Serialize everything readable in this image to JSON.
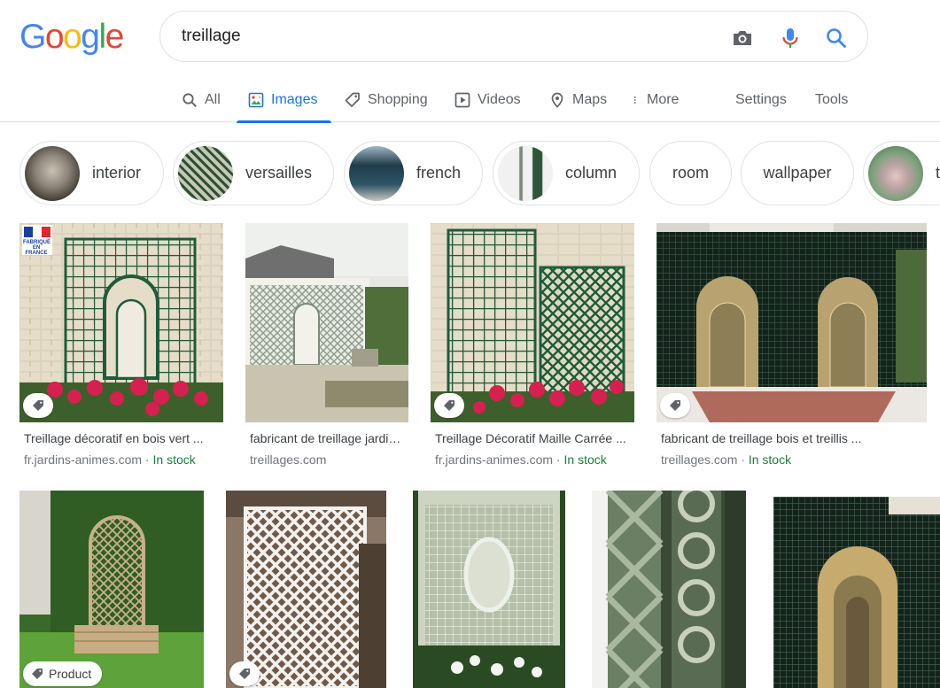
{
  "logo": {
    "letters": [
      "G",
      "o",
      "o",
      "g",
      "l",
      "e"
    ]
  },
  "search": {
    "query": "treillage"
  },
  "tabs": {
    "all": "All",
    "images": "Images",
    "shopping": "Shopping",
    "videos": "Videos",
    "maps": "Maps",
    "more": "More",
    "settings": "Settings",
    "tools": "Tools"
  },
  "chips": [
    "interior",
    "versailles",
    "french",
    "column",
    "room",
    "wallpaper",
    "t"
  ],
  "results_row1": [
    {
      "title": "Treillage décoratif en bois vert ...",
      "source": "fr.jardins-animes.com",
      "sep": " · ",
      "stock": "In stock",
      "badge_overlay": "FABRIQUÉ EN FRANCE"
    },
    {
      "title": "fabricant de treillage jardin ...",
      "source": "treillages.com",
      "sep": "",
      "stock": ""
    },
    {
      "title": "Treillage Décoratif Maille Carrée ...",
      "source": "fr.jardins-animes.com",
      "sep": " · ",
      "stock": "In stock"
    },
    {
      "title": "fabricant de treillage bois et treillis ...",
      "source": "treillages.com",
      "sep": " · ",
      "stock": "In stock"
    }
  ],
  "results_row2": {
    "badge_product": "Product"
  },
  "colors": {
    "accent": "#1a73e8",
    "stock_green": "#188038",
    "trellis_green": "#1f5c3a"
  }
}
